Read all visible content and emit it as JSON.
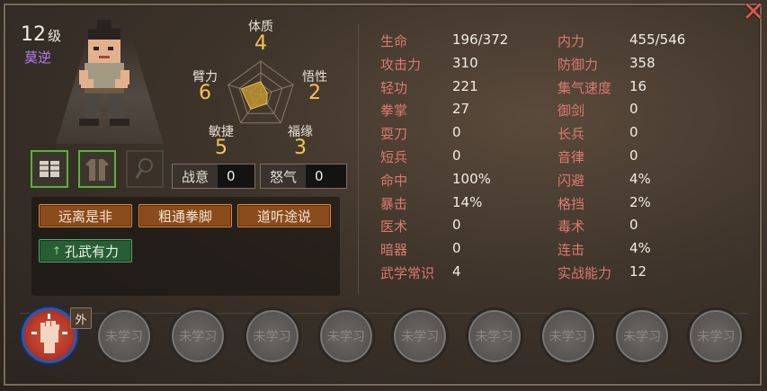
{
  "character": {
    "level": "12",
    "level_unit": "级",
    "name": "莫逆",
    "name_color": "#b67df0"
  },
  "attributes": {
    "tizhi": {
      "label": "体质",
      "value": "4"
    },
    "wuxing": {
      "label": "悟性",
      "value": "2"
    },
    "fuyuan": {
      "label": "福缘",
      "value": "3"
    },
    "minjie": {
      "label": "敏捷",
      "value": "5"
    },
    "bili": {
      "label": "臂力",
      "value": "6"
    }
  },
  "radar_values": {
    "tizhi": 4,
    "wuxing": 2,
    "fuyuan": 3,
    "minjie": 5,
    "bili": 6,
    "max": 10
  },
  "equipment": [
    {
      "icon": "bandage-gloves-icon",
      "equipped": true
    },
    {
      "icon": "robe-armor-icon",
      "equipped": true
    },
    {
      "icon": "accessory-slot-icon",
      "equipped": false
    }
  ],
  "fields": {
    "zhanyi": {
      "label": "战意",
      "value": "0"
    },
    "nuqi": {
      "label": "怒气",
      "value": "0"
    }
  },
  "traits": [
    {
      "label": "远离是非",
      "style": "orange"
    },
    {
      "label": "粗通拳脚",
      "style": "orange"
    },
    {
      "label": "道听途说",
      "style": "orange"
    },
    {
      "label": "孔武有力",
      "style": "green",
      "arrow": "↑"
    }
  ],
  "stats_left": [
    {
      "k": "生命",
      "v": "196/372"
    },
    {
      "k": "攻击力",
      "v": "310"
    },
    {
      "k": "轻功",
      "v": "221"
    },
    {
      "k": "拳掌",
      "v": "27"
    },
    {
      "k": "耍刀",
      "v": "0"
    },
    {
      "k": "短兵",
      "v": "0"
    },
    {
      "k": "命中",
      "v": "100%"
    },
    {
      "k": "暴击",
      "v": "14%"
    },
    {
      "k": "医术",
      "v": "0"
    },
    {
      "k": "暗器",
      "v": "0"
    },
    {
      "k": "武学常识",
      "v": "4"
    }
  ],
  "stats_right": [
    {
      "k": "内力",
      "v": "455/546"
    },
    {
      "k": "防御力",
      "v": "358"
    },
    {
      "k": "集气速度",
      "v": "16"
    },
    {
      "k": "御剑",
      "v": "0"
    },
    {
      "k": "长兵",
      "v": "0"
    },
    {
      "k": "音律",
      "v": "0"
    },
    {
      "k": "闪避",
      "v": "4%"
    },
    {
      "k": "格挡",
      "v": "2%"
    },
    {
      "k": "毒术",
      "v": "0"
    },
    {
      "k": "连击",
      "v": "4%"
    },
    {
      "k": "实战能力",
      "v": "12"
    }
  ],
  "skills": {
    "active": {
      "icon": "fist-skill-icon",
      "tag": "外"
    },
    "locked_label": "未学习",
    "locked_count": 9
  },
  "colors": {
    "stat_key": "#dc7a6c",
    "attr_value": "#f5c453",
    "close": "#d9584e"
  }
}
